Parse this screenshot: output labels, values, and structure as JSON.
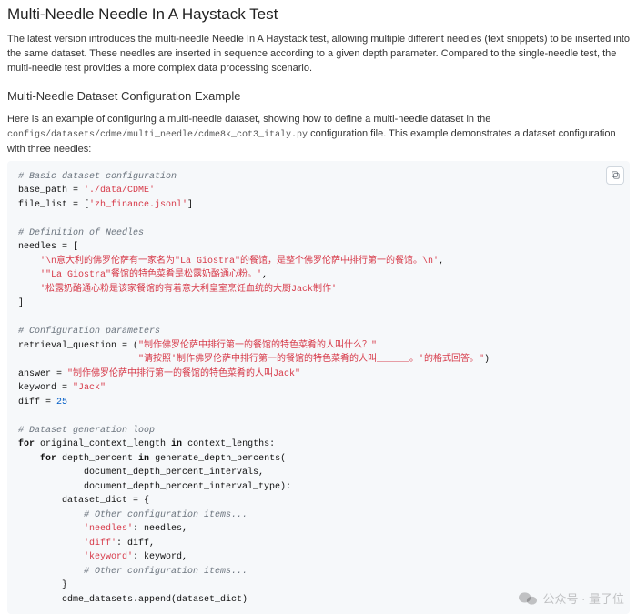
{
  "heading": "Multi-Needle Needle In A Haystack Test",
  "intro": "The latest version introduces the multi-needle Needle In A Haystack test, allowing multiple different needles (text snippets) to be inserted into the same dataset. These needles are inserted in sequence according to a given depth parameter. Compared to the single-needle test, the multi-needle test provides a more complex data processing scenario.",
  "subheading": "Multi-Needle Dataset Configuration Example",
  "desc_line1": "Here is an example of configuring a multi-needle dataset, showing how to define a multi-needle dataset in the",
  "config_path": "configs/datasets/cdme/multi_needle/cdme8k_cot3_italy.py",
  "desc_line2_suffix": " configuration file. This example demonstrates a dataset configuration with three needles:",
  "code": {
    "c1": "# Basic dataset configuration",
    "l_base_path_k": "base_path = ",
    "l_base_path_v": "'./data/CDME'",
    "l_file_list_k": "file_list = [",
    "l_file_list_v": "'zh_finance.jsonl'",
    "l_file_list_close": "]",
    "c2": "# Definition of Needles",
    "l_needles_open": "needles = [",
    "needle1": "'\\n意大利的佛罗伦萨有一家名为\"La Giostra\"的餐馆，是整个佛罗伦萨中排行第一的餐馆。\\n'",
    "needle2": "'\"La Giostra\"餐馆的特色菜肴是松露奶酪通心粉。'",
    "needle3": "'松露奶酪通心粉是该家餐馆的有着意大利皇室烹饪血统的大厨Jack制作'",
    "l_needles_close": "]",
    "c3": "# Configuration parameters",
    "l_rq_open": "retrieval_question = (",
    "rq1": "\"制作佛罗伦萨中排行第一的餐馆的特色菜肴的人叫什么？\"",
    "rq2": "\"请按照'制作佛罗伦萨中排行第一的餐馆的特色菜肴的人叫______。'的格式回答。\"",
    "rq_close": ")",
    "l_answer_k": "answer = ",
    "l_answer_v": "\"制作佛罗伦萨中排行第一的餐馆的特色菜肴的人叫Jack\"",
    "l_keyword_k": "keyword = ",
    "l_keyword_v": "\"Jack\"",
    "l_diff_k": "diff = ",
    "l_diff_v": "25",
    "c4": "# Dataset generation loop",
    "loop_for1": "for",
    "loop_text1": " original_context_length ",
    "loop_in1": "in",
    "loop_text1b": " context_lengths:",
    "loop_for2": "for",
    "loop_text2": " depth_percent ",
    "loop_in2": "in",
    "loop_text2b": " generate_depth_percents(",
    "loop_arg1": "document_depth_percent_intervals,",
    "loop_arg2": "document_depth_percent_interval_type):",
    "l_dict_open": "dataset_dict = {",
    "c5": "# Other configuration items...",
    "kv_needles_k": "'needles'",
    "kv_needles_v": ": needles,",
    "kv_diff_k": "'diff'",
    "kv_diff_v": ": diff,",
    "kv_keyword_k": "'keyword'",
    "kv_keyword_v": ": keyword,",
    "c6": "# Other configuration items...",
    "l_dict_close": "}",
    "l_append": "cdme_datasets.append(dataset_dict)"
  },
  "watermark_text": "公众号 · 量子位"
}
